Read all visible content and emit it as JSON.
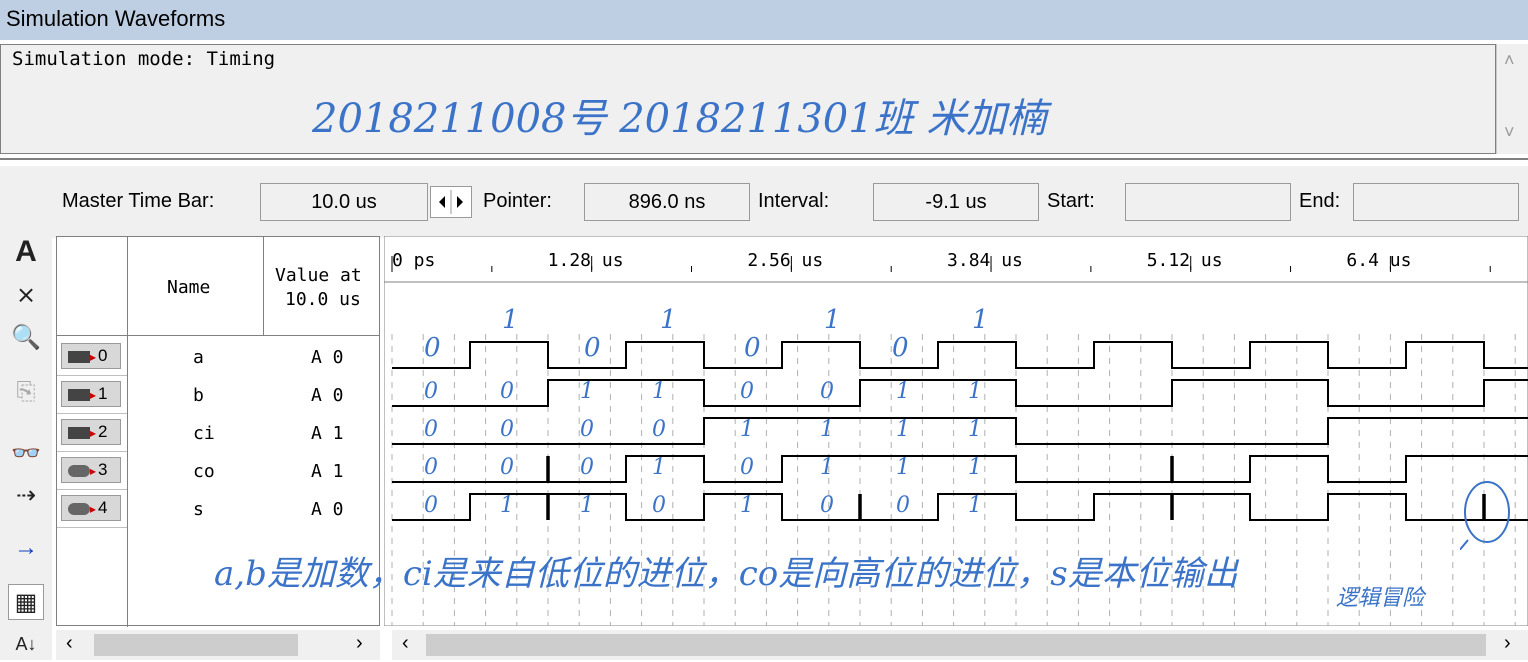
{
  "window": {
    "title": "Simulation Waveforms"
  },
  "mode_panel": {
    "text": "Simulation mode: Timing",
    "handwriting": "2018211008号  2018211301班  米加楠"
  },
  "toolbar": {
    "master_time_bar_label": "Master Time Bar:",
    "master_time_bar_value": "10.0 us",
    "pointer_label": "Pointer:",
    "pointer_value": "896.0 ns",
    "interval_label": "Interval:",
    "interval_value": "-9.1 us",
    "start_label": "Start:",
    "start_value": "",
    "end_label": "End:",
    "end_value": ""
  },
  "left_tools": [
    "selection-tool-icon",
    "text-tool-icon",
    "waveform-editing-icon",
    "zoom-icon",
    "copy-icon",
    "find-icon",
    "find-next-icon",
    "arrow-icon",
    "grid-icon",
    "sort-icon"
  ],
  "signal_table": {
    "col_name": "Name",
    "col_value_line1": "Value at",
    "col_value_line2": "10.0 us",
    "rows": [
      {
        "index": "0",
        "name": "a",
        "value": "A 0",
        "io": "input"
      },
      {
        "index": "1",
        "name": "b",
        "value": "A 0",
        "io": "input"
      },
      {
        "index": "2",
        "name": "ci",
        "value": "A 1",
        "io": "input"
      },
      {
        "index": "3",
        "name": "co",
        "value": "A 1",
        "io": "output"
      },
      {
        "index": "4",
        "name": "s",
        "value": "A 0",
        "io": "output"
      }
    ]
  },
  "timeline": {
    "ticks": [
      "0 ps",
      "1.28 us",
      "2.56 us",
      "3.84 us",
      "5.12 us",
      "6.4 us"
    ],
    "transition_marker_edges_us": [
      1.0,
      2.0,
      3.0,
      4.0,
      5.0,
      6.0,
      7.0
    ]
  },
  "waveforms": {
    "unit_us": 1.0,
    "a": [
      0,
      1,
      0,
      1,
      0,
      1,
      0,
      1,
      0,
      1,
      0,
      1,
      0,
      1,
      0,
      1
    ],
    "b": [
      0,
      0,
      1,
      1,
      0,
      0,
      1,
      1,
      0,
      0,
      1,
      1,
      0,
      0,
      1,
      1
    ],
    "ci": [
      0,
      0,
      0,
      0,
      1,
      1,
      1,
      1,
      0,
      0,
      0,
      0,
      1,
      1,
      1,
      1
    ],
    "co": [
      0,
      0,
      0,
      1,
      0,
      1,
      1,
      1,
      0,
      0,
      0,
      1,
      0,
      1,
      1,
      1
    ],
    "s": [
      0,
      1,
      1,
      0,
      1,
      0,
      0,
      1,
      0,
      1,
      1,
      0,
      1,
      0,
      0,
      1
    ],
    "glitches_us": {
      "co": [
        2.0,
        10.0
      ],
      "s": [
        2.0,
        6.0,
        10.0,
        14.0
      ]
    }
  },
  "annotations": {
    "top_digits": [
      "1",
      "1",
      "1",
      "1"
    ],
    "a_row": [
      "0",
      "0",
      "0",
      "0"
    ],
    "b_row": [
      "0",
      "0",
      "1",
      "1",
      "0",
      "0",
      "1",
      "1"
    ],
    "ci_row": [
      "0",
      "0",
      "0",
      "0",
      "1",
      "1",
      "1",
      "1"
    ],
    "co_row": [
      "0",
      "0",
      "0",
      "1",
      "0",
      "1",
      "1",
      "1"
    ],
    "s_row": [
      "0",
      "1",
      "1",
      "0",
      "1",
      "0",
      "0",
      "1"
    ],
    "bottom_note": "a,b是加数，ci是来自低位的进位，co是向高位的进位，s是本位输出",
    "glitch_note": "逻辑冒险"
  },
  "colors": {
    "handwriting": "#3a73c8",
    "titlebar": "#bfcfe3",
    "panel": "#f0f0f0"
  }
}
